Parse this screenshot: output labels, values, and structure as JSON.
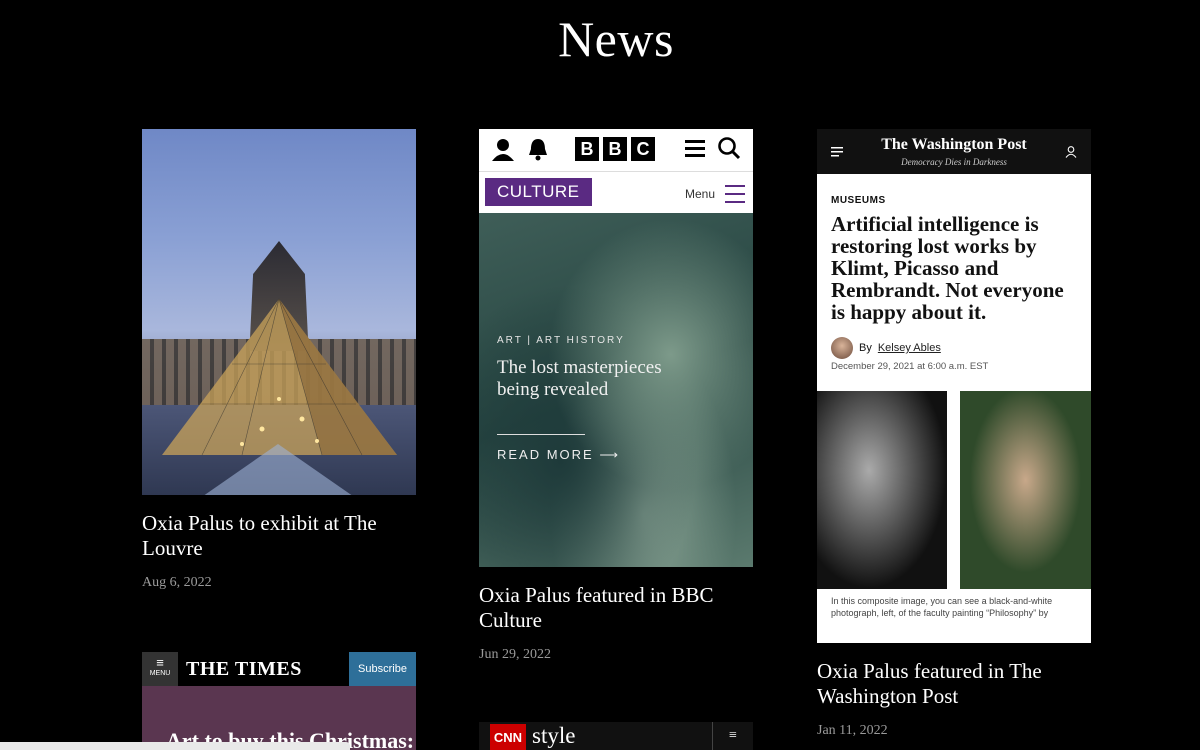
{
  "page": {
    "title": "News"
  },
  "articles": [
    {
      "title": "Oxia Palus to exhibit at The Louvre",
      "date": "Aug 6, 2022"
    },
    {
      "title": "Oxia Palus featured in BBC Culture",
      "date": "Jun 29, 2022"
    },
    {
      "title": "Oxia Palus featured in The Washington Post",
      "date": "Jan 11, 2022"
    }
  ],
  "bbc": {
    "logo_letters": [
      "B",
      "B",
      "C"
    ],
    "section": "CULTURE",
    "menu_label": "Menu",
    "kicker": "ART | ART HISTORY",
    "headline": "The lost masterpieces being revealed",
    "read_more": "READ MORE"
  },
  "wapo": {
    "brand": "The Washington Post",
    "tagline": "Democracy Dies in Darkness",
    "section": "MUSEUMS",
    "headline": "Artificial intelligence is restoring lost works by Klimt, Picasso and Rembrandt. Not everyone is happy about it.",
    "by": "By",
    "author": "Kelsey Ables",
    "dateline": "December 29, 2021 at 6:00 a.m. EST",
    "caption": "In this composite image, you can see a black-and-white photograph, left, of the faculty painting “Philosophy” by"
  },
  "times": {
    "menu_label": "MENU",
    "logo": "THE TIMES",
    "subscribe": "Subscribe",
    "headline": "Art to buy this Christmas:"
  },
  "cnn": {
    "logo": "CNN",
    "word": "style"
  }
}
